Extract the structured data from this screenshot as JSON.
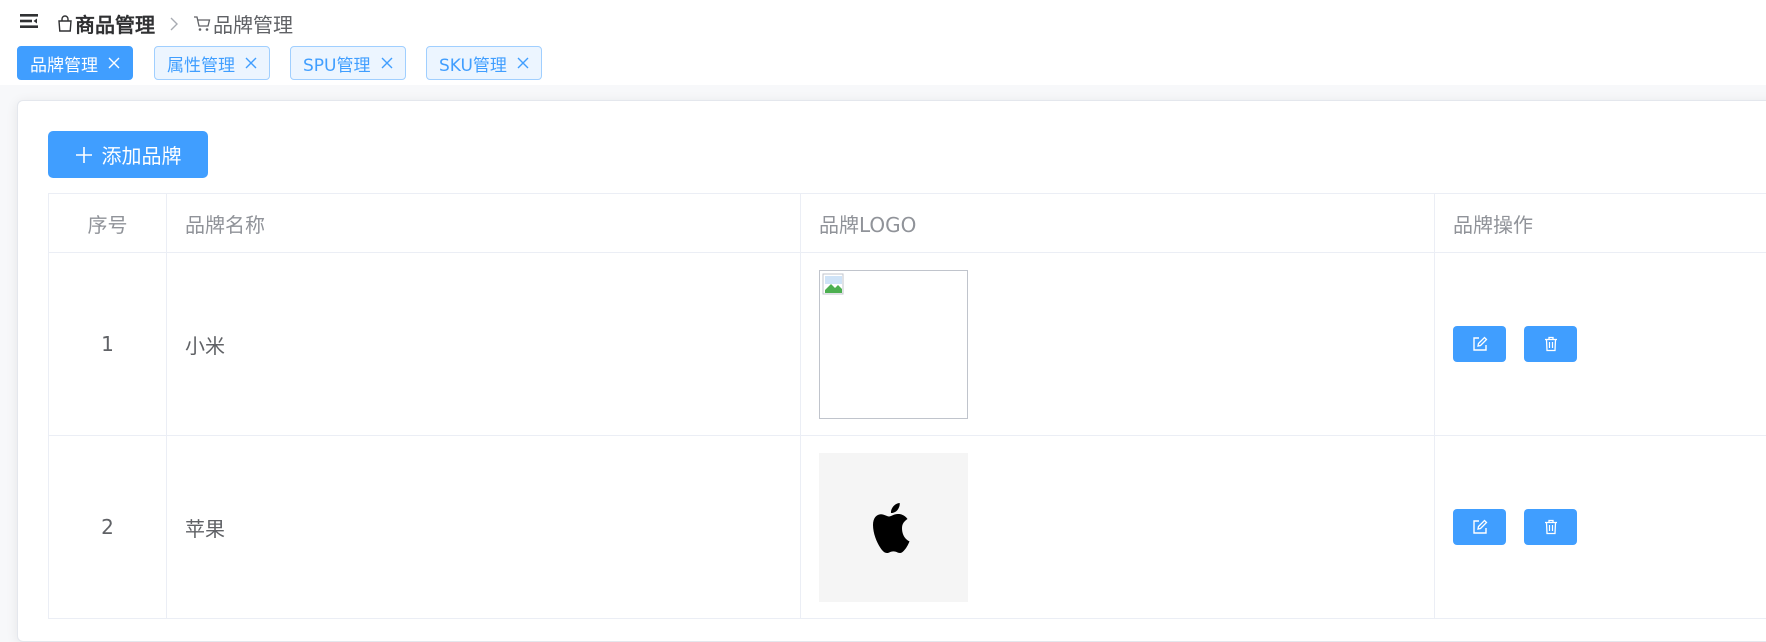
{
  "header": {
    "breadcrumb": [
      {
        "label": "商品管理",
        "icon": "shopping-bag-icon"
      },
      {
        "label": "品牌管理",
        "icon": "shopping-cart-icon"
      }
    ]
  },
  "tabs": [
    {
      "label": "品牌管理",
      "active": true
    },
    {
      "label": "属性管理",
      "active": false
    },
    {
      "label": "SPU管理",
      "active": false
    },
    {
      "label": "SKU管理",
      "active": false
    }
  ],
  "toolbar": {
    "add_label": "添加品牌"
  },
  "table": {
    "columns": [
      "序号",
      "品牌名称",
      "品牌LOGO",
      "品牌操作"
    ],
    "rows": [
      {
        "index": "1",
        "name": "小米",
        "logo": "broken-image"
      },
      {
        "index": "2",
        "name": "苹果",
        "logo": "apple-logo"
      }
    ]
  },
  "colors": {
    "primary": "#409eff",
    "tag_bg": "#ecf5ff",
    "border": "#ebeef5"
  }
}
